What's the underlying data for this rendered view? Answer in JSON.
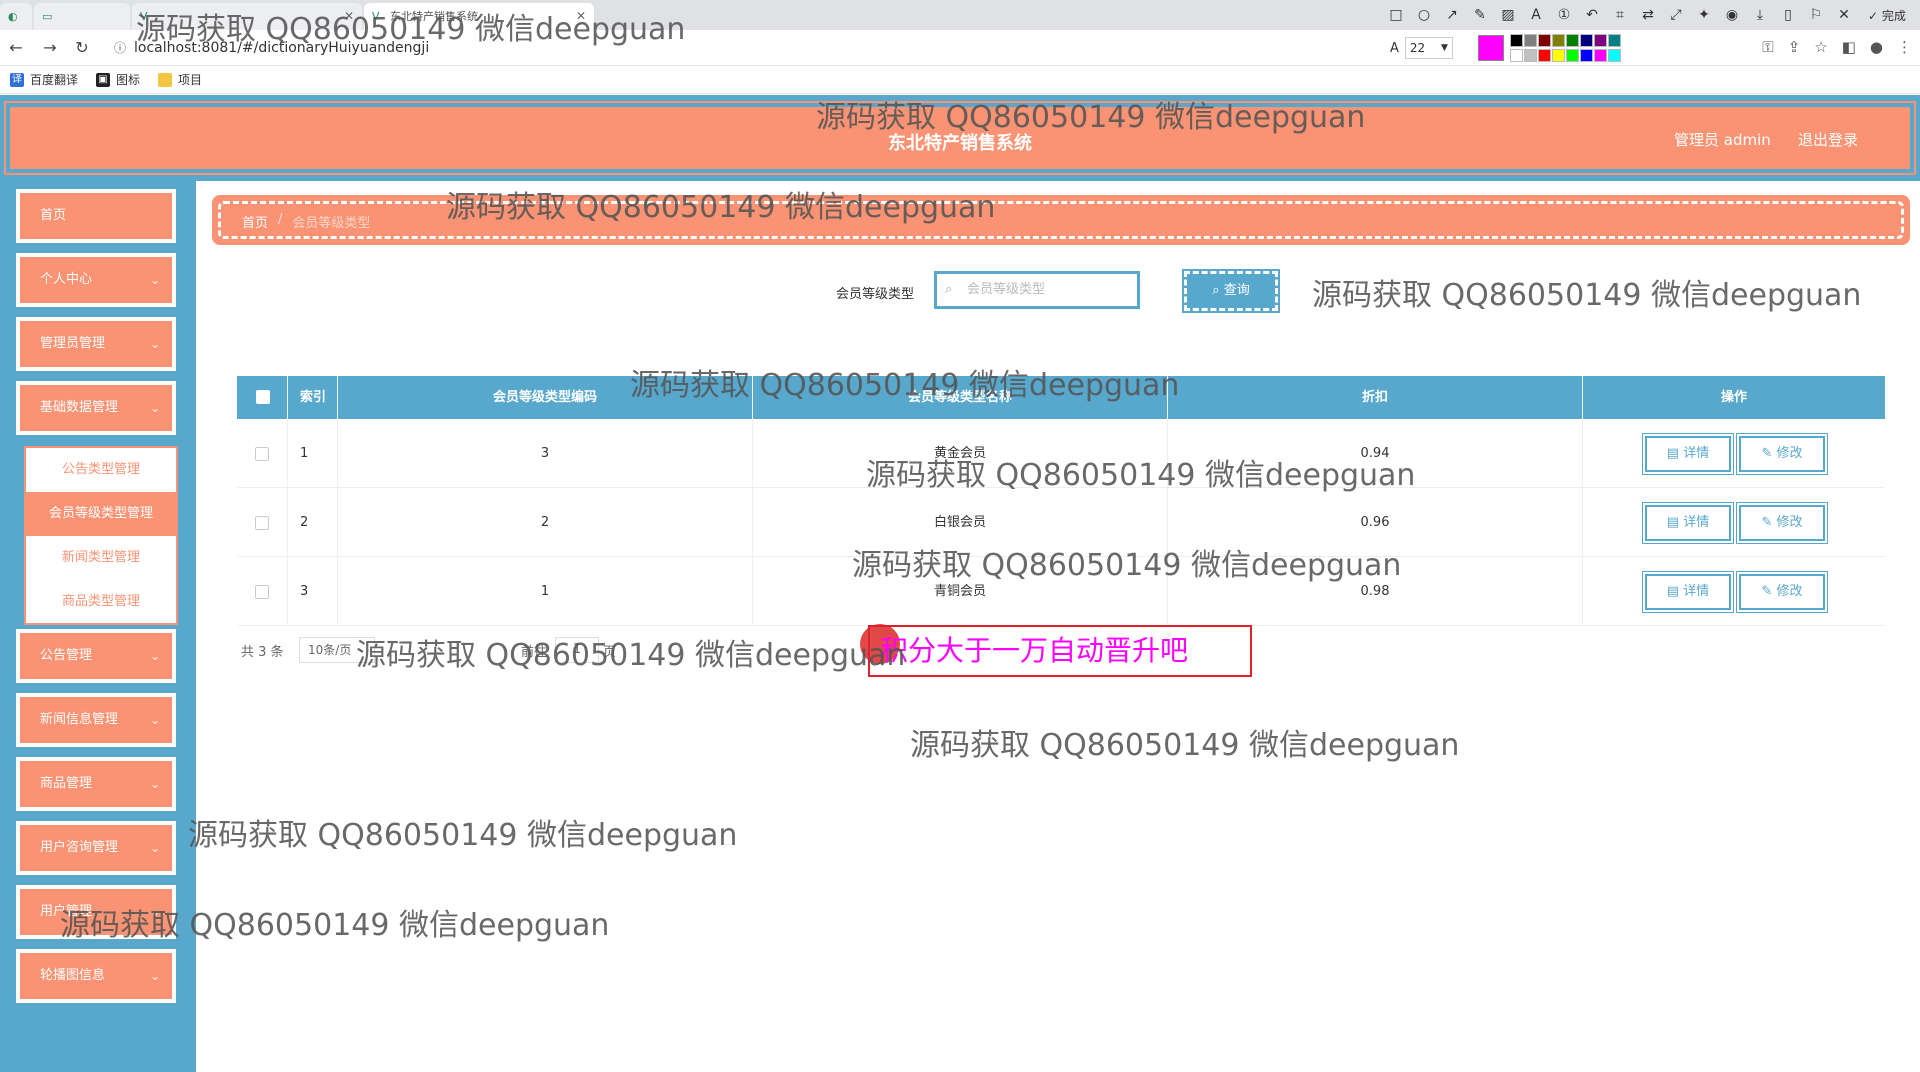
{
  "browser": {
    "tabs": [
      {
        "label": "",
        "active": false
      },
      {
        "label": "",
        "active": false
      },
      {
        "label": "东北特产销售系统",
        "active": true
      }
    ],
    "url": "localhost:8081/#/dictionaryHuiyuandengji",
    "font_size": "22",
    "pen_color": "#ff00ff",
    "done_label": "完成",
    "bookmarks": [
      {
        "label": "百度翻译",
        "icon": "translate-icon"
      },
      {
        "label": "图标",
        "icon": "icon-folder"
      },
      {
        "label": "项目",
        "icon": "folder-icon"
      }
    ]
  },
  "header": {
    "title": "东北特产销售系统",
    "admin": "管理员 admin",
    "logout": "退出登录"
  },
  "sidebar": {
    "items": [
      {
        "label": "首页",
        "expandable": false
      },
      {
        "label": "个人中心",
        "expandable": true
      },
      {
        "label": "管理员管理",
        "expandable": true
      },
      {
        "label": "基础数据管理",
        "expandable": true
      },
      {
        "label": "公告管理",
        "expandable": true
      },
      {
        "label": "新闻信息管理",
        "expandable": true
      },
      {
        "label": "商品管理",
        "expandable": true
      },
      {
        "label": "用户咨询管理",
        "expandable": true
      },
      {
        "label": "用户管理",
        "expandable": true
      },
      {
        "label": "轮播图信息",
        "expandable": true
      }
    ],
    "submenu": [
      {
        "label": "公告类型管理",
        "active": false
      },
      {
        "label": "会员等级类型管理",
        "active": true
      },
      {
        "label": "新闻类型管理",
        "active": false
      },
      {
        "label": "商品类型管理",
        "active": false
      }
    ]
  },
  "breadcrumb": {
    "home": "首页",
    "separator": "/",
    "current": "会员等级类型"
  },
  "search": {
    "label": "会员等级类型",
    "placeholder": "会员等级类型",
    "button": "查询"
  },
  "table": {
    "columns": [
      "",
      "索引",
      "会员等级类型编码",
      "会员等级类型名称",
      "折扣",
      "操作"
    ],
    "rows": [
      {
        "index": "1",
        "code": "3",
        "name": "黄金会员",
        "discount": "0.94"
      },
      {
        "index": "2",
        "code": "2",
        "name": "白银会员",
        "discount": "0.96"
      },
      {
        "index": "3",
        "code": "1",
        "name": "青铜会员",
        "discount": "0.98"
      }
    ],
    "detail_label": "详情",
    "edit_label": "修改"
  },
  "pager": {
    "total": "共 3 条",
    "page_size": "10条/页",
    "goto": "前往",
    "page": "1",
    "page_suffix": "页"
  },
  "annotation": "积分大于一万自动晋升吧",
  "watermark": "源码获取 QQ86050149 微信deepguan"
}
